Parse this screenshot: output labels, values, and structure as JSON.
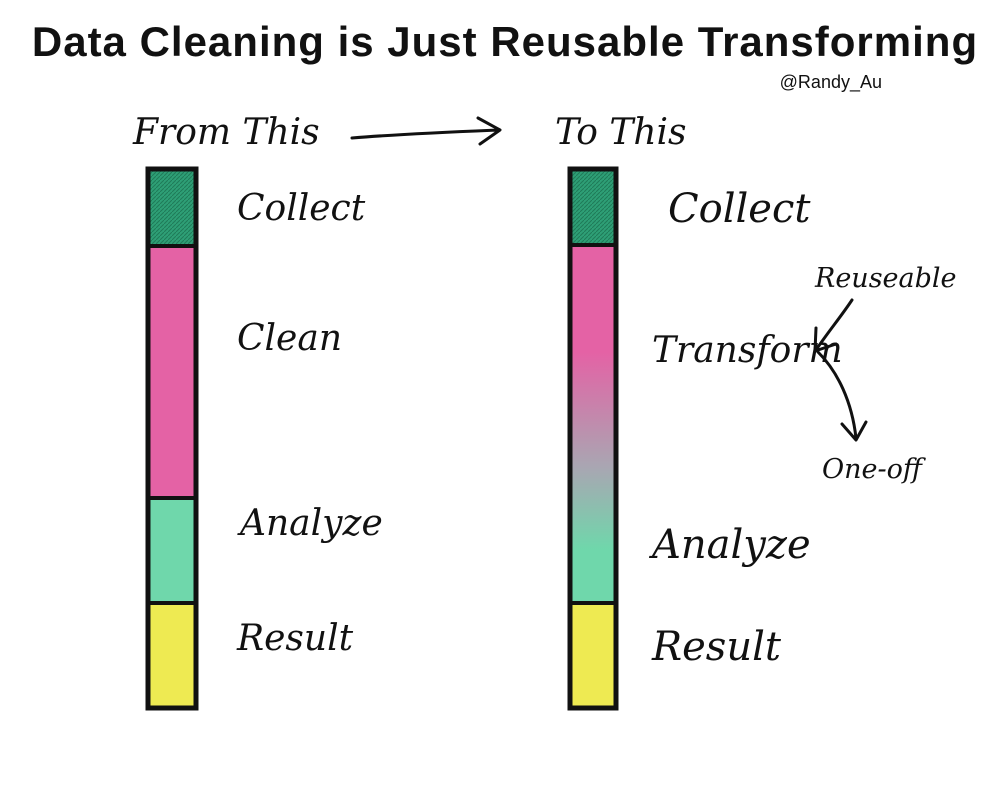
{
  "title": "Data Cleaning is Just Reusable Transforming",
  "author": "@Randy_Au",
  "colors": {
    "collect": "#2e9f76",
    "clean": "#e462a5",
    "transform_mid": "#a9a6b2",
    "analyze": "#6fd7ab",
    "result": "#eeea52",
    "ink": "#111111"
  },
  "left": {
    "header": "From This",
    "stages": [
      {
        "label": "Collect",
        "share": 0.15
      },
      {
        "label": "Clean",
        "share": 0.47
      },
      {
        "label": "Analyze",
        "share": 0.2
      },
      {
        "label": "Result",
        "share": 0.2
      }
    ]
  },
  "right": {
    "header": "To This",
    "stages": [
      {
        "label": "Collect",
        "share": 0.14
      },
      {
        "label": "Transform",
        "share": 0.67
      },
      {
        "label": "Result",
        "share": 0.2
      }
    ],
    "blended_label": "Analyze",
    "branch_reusable": "Reuseable",
    "branch_oneoff": "One-off"
  }
}
